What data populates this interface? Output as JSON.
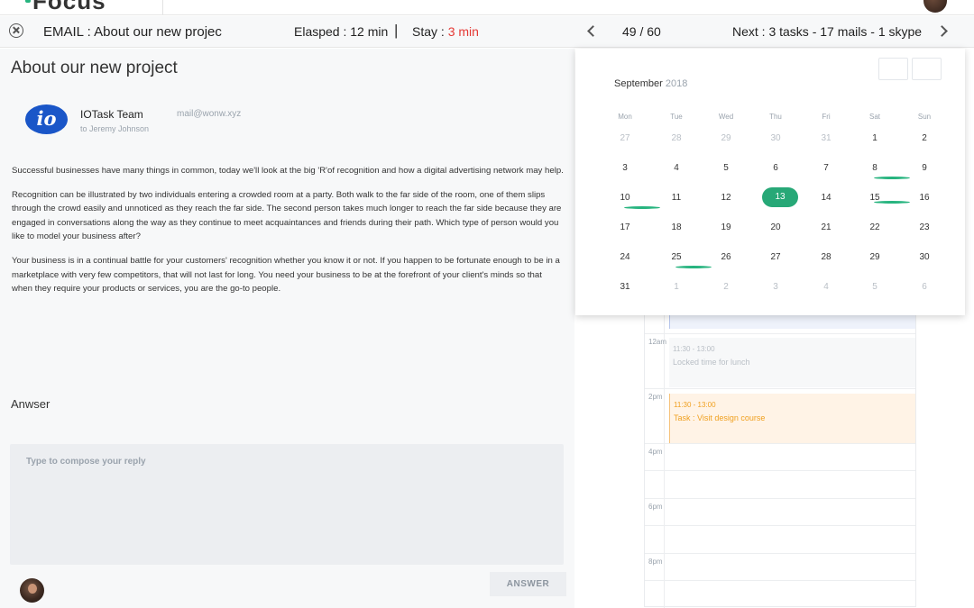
{
  "topbar": {
    "logo": "Focus"
  },
  "subbar": {
    "title": "EMAIL : About our new projec",
    "elapsed": "Elasped : 12 min",
    "divider": "|",
    "stay_label": "Stay :",
    "stay_value": "3 min",
    "counter": "49 / 60",
    "next": "Next : 3 tasks - 17 mails - 1 skype"
  },
  "email": {
    "subject": "About our new project",
    "logo_text": "io",
    "sender_name": "IOTask Team",
    "sender_mail": "mail@wonw.xyz",
    "to": "to Jeremy Johnson",
    "paragraphs": [
      "Successful businesses have many things in common, today we'll look at the big 'R'of recognition and how a digital advertising network may help.",
      "Recognition can be illustrated by two individuals entering a crowded room at a party. Both walk to the far side of the room, one of them slips through the crowd easily and unnoticed as they reach the far side. The second person takes much longer to reach the far side because they are engaged in conversations along the way as they continue to meet acquaintances and friends during their path. Which type of person would you like to model your business after?",
      "Your business is in a continual battle for your customers' recognition whether you know it or not. If you happen to be fortunate enough to be in a marketplace with very few competitors, that will not last for long. You need your business to be at the forefront of your client's minds so that when they require your products or services, you are the go-to people."
    ],
    "answer_label": "Anwser",
    "reply_placeholder": "Type to compose your reply",
    "answer_button": "ANSWER"
  },
  "calendar": {
    "month": "September",
    "year": "2018",
    "weekdays": [
      "Mon",
      "Tue",
      "Wed",
      "Thu",
      "Fri",
      "Sat",
      "Sun"
    ],
    "weeks": [
      [
        "27",
        "28",
        "29",
        "30",
        "31",
        "1",
        "2"
      ],
      [
        "3",
        "4",
        "5",
        "6",
        "7",
        "8",
        "9"
      ],
      [
        "10",
        "11",
        "12",
        "13",
        "14",
        "15",
        "16"
      ],
      [
        "17",
        "18",
        "19",
        "20",
        "21",
        "22",
        "23"
      ],
      [
        "24",
        "25",
        "26",
        "27",
        "28",
        "29",
        "30"
      ],
      [
        "31",
        "1",
        "2",
        "3",
        "4",
        "5",
        "6"
      ]
    ],
    "selected_day": "13",
    "accent_color": "#27a877"
  },
  "schedule": {
    "times": [
      "12am",
      "2pm",
      "4pm",
      "6pm",
      "8pm"
    ],
    "events": [
      {
        "time": "11:30 - 13:00",
        "title": "Locked time for lunch"
      },
      {
        "time": "11:30 - 13:00",
        "title": "Task : Visit design course"
      }
    ]
  }
}
